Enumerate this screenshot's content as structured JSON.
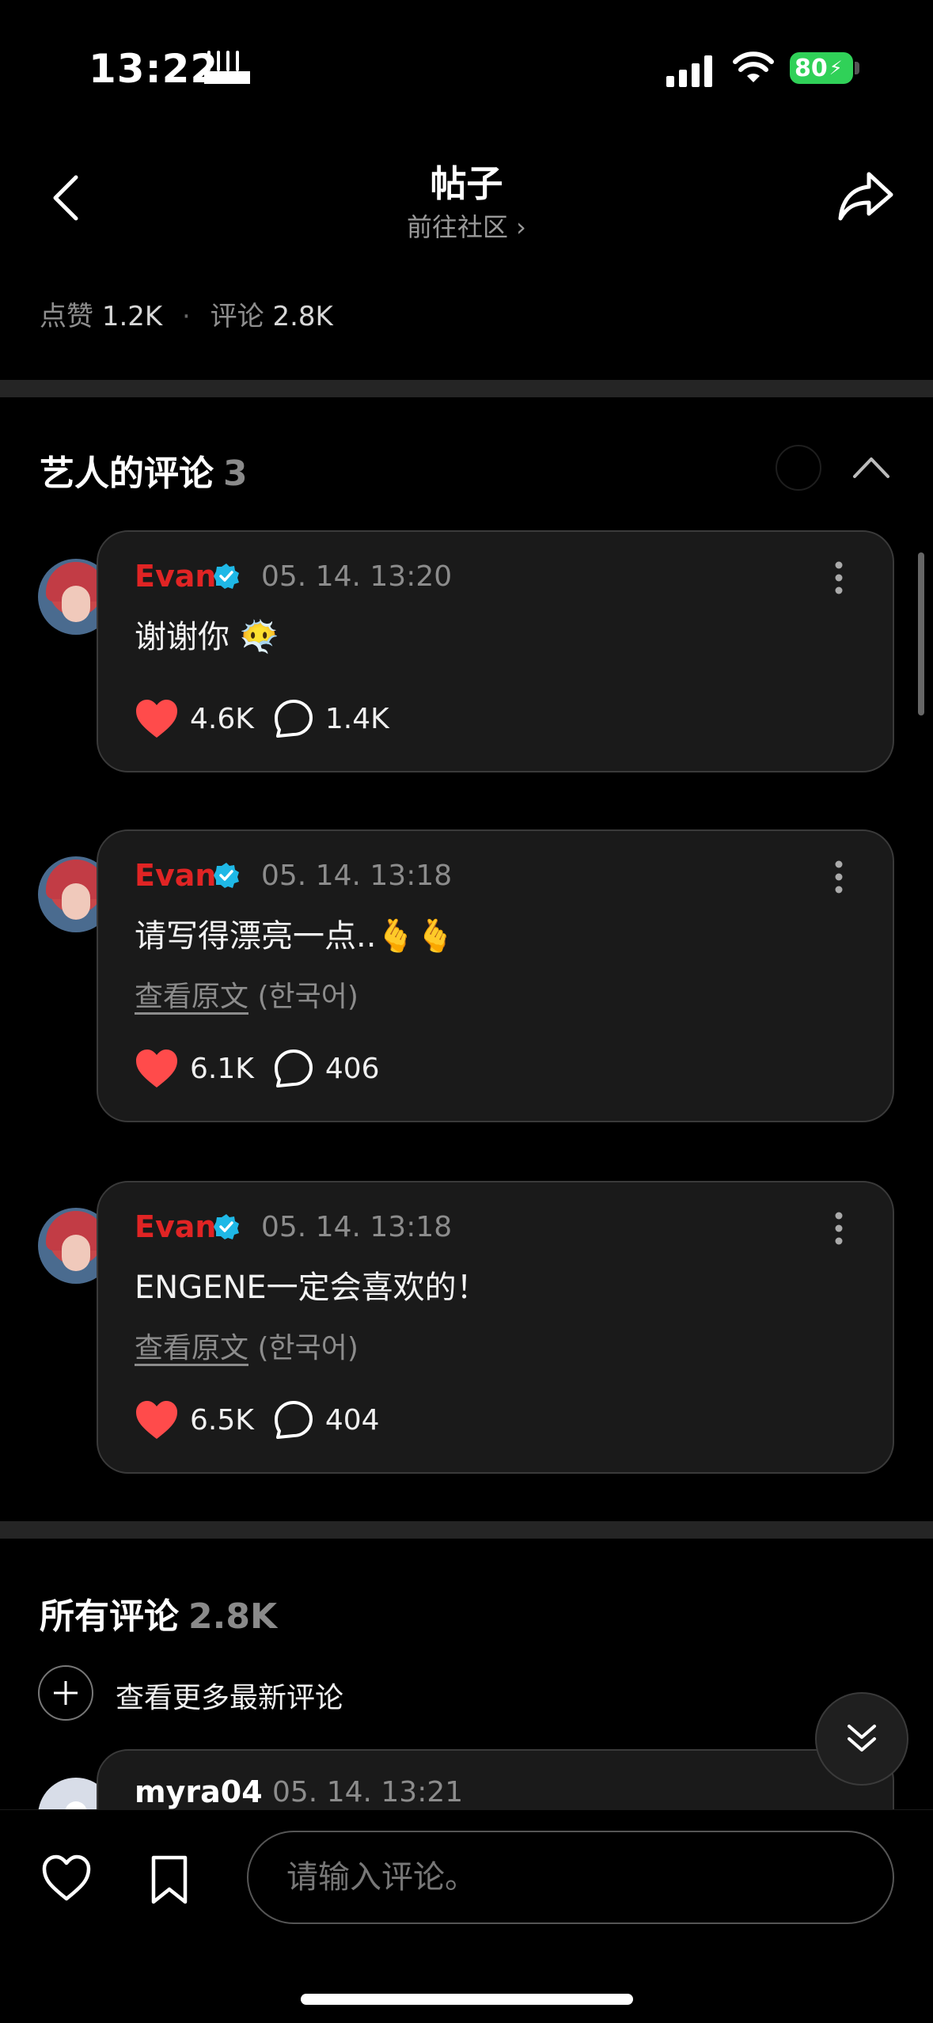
{
  "status_bar": {
    "time": "13:22",
    "battery": "80"
  },
  "header": {
    "title": "帖子",
    "community_link": "前往社区 ›"
  },
  "stats": {
    "likes_label": "点赞",
    "likes_value": "1.2K",
    "separator": "·",
    "comments_label": "评论",
    "comments_value": "2.8K"
  },
  "artist_section": {
    "title": "艺人的评论",
    "count": "3"
  },
  "artist_comments": [
    {
      "author": "Evan",
      "time": "05. 14. 13:20",
      "text": "谢谢你 😶‍🌫️",
      "likes": "4.6K",
      "replies": "1.4K"
    },
    {
      "author": "Evan",
      "time": "05. 14. 13:18",
      "text": "请写得漂亮一点..🫰🫰",
      "translate_link": "查看原文",
      "translate_lang": "(한국어)",
      "likes": "6.1K",
      "replies": "406"
    },
    {
      "author": "Evan",
      "time": "05. 14. 13:18",
      "text": "ENGENE一定会喜欢的！",
      "translate_link": "查看原文",
      "translate_lang": "(한국어)",
      "likes": "6.5K",
      "replies": "404"
    }
  ],
  "all_section": {
    "title": "所有评论",
    "count": "2.8K",
    "more_newest": "查看更多最新评论"
  },
  "peek_comment": {
    "author": "myra04",
    "time": "05. 14. 13:21"
  },
  "bottom_bar": {
    "input_placeholder": "请输入评论。"
  },
  "colors": {
    "author_red": "#e02424",
    "verified": "#1fb8e6",
    "heart": "#ff4b4b",
    "battery": "#30d158"
  },
  "icons": [
    "back-icon",
    "share-icon",
    "verified-icon",
    "more-icon",
    "heart-icon",
    "bubble-icon",
    "collapse-icon",
    "scroll-down-icon",
    "like-icon",
    "bookmark-icon"
  ]
}
